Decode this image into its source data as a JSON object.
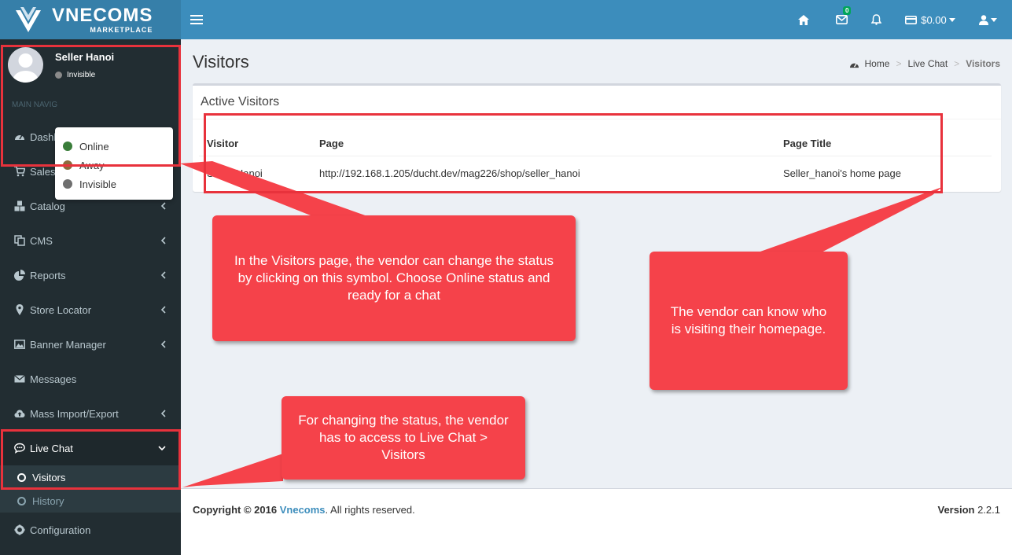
{
  "brand": {
    "name": "VNECOMS",
    "sub": "MARKETPLACE"
  },
  "header": {
    "balance": "$0.00",
    "mail_badge": "0"
  },
  "user": {
    "name": "Seller Hanoi",
    "status": "Invisible"
  },
  "status_menu": [
    {
      "label": "Online",
      "color": "#3a7d3a"
    },
    {
      "label": "Away",
      "color": "#8b6b3d"
    },
    {
      "label": "Invisible",
      "color": "#6f6f6f"
    }
  ],
  "nav_header": "MAIN NAVIG",
  "nav": {
    "dashboard": "Dashb",
    "sales": "Sales",
    "catalog": "Catalog",
    "cms": "CMS",
    "reports": "Reports",
    "store_locator": "Store Locator",
    "banner_manager": "Banner Manager",
    "messages": "Messages",
    "mass_import": "Mass Import/Export",
    "live_chat": "Live Chat",
    "visitors": "Visitors",
    "history": "History",
    "configuration": "Configuration"
  },
  "page": {
    "title": "Visitors"
  },
  "breadcrumb": {
    "home": "Home",
    "live_chat": "Live Chat",
    "current": "Visitors"
  },
  "box": {
    "title": "Active Visitors",
    "columns": [
      "Visitor",
      "Page",
      "Page Title"
    ],
    "rows": [
      [
        "Seller Hanoi",
        "http://192.168.1.205/ducht.dev/mag226/shop/seller_hanoi",
        "Seller_hanoi's home page"
      ]
    ]
  },
  "footer": {
    "copyright": "Copyright © 2016",
    "company": "Vnecoms",
    "rights": ". All rights reserved.",
    "version_label": "Version",
    "version": "2.2.1"
  },
  "callouts": {
    "status": "In the Visitors page, the vendor can change the status by clicking on this symbol. Choose Online status and ready for a chat",
    "visitors": "The vendor can know who is visiting their homepage.",
    "access": "For changing the status, the vendor has to access to Live Chat > Visitors"
  },
  "colors": {
    "accent": "#3c8dbc",
    "callout": "#f5424a",
    "highlight": "#e8323c",
    "sidebar": "#222d32"
  }
}
